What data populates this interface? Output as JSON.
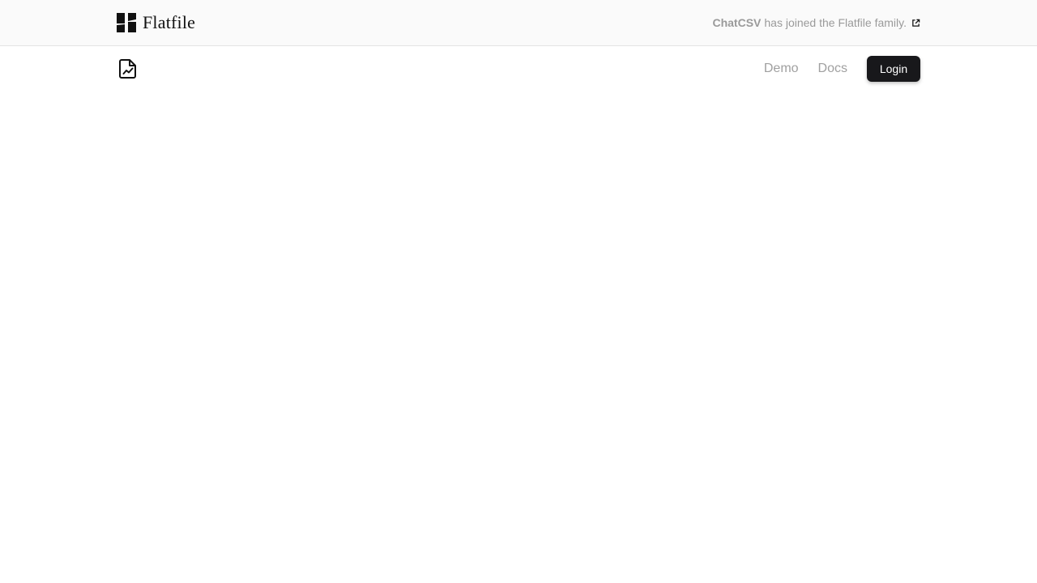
{
  "banner": {
    "brand_name": "Flatfile",
    "brand_icon": "flatfile-logo-icon",
    "announcement_strong": "ChatCSV",
    "announcement_rest": "has joined the Flatfile family.",
    "announcement_icon": "external-link-icon"
  },
  "nav": {
    "logo_icon": "file-chart-icon",
    "links": [
      {
        "label": "Demo"
      },
      {
        "label": "Docs"
      }
    ],
    "login_label": "Login"
  },
  "colors": {
    "banner_bg": "#fafafa",
    "muted_text": "#9a9a9a",
    "button_bg": "#18181b",
    "button_text": "#ffffff"
  }
}
